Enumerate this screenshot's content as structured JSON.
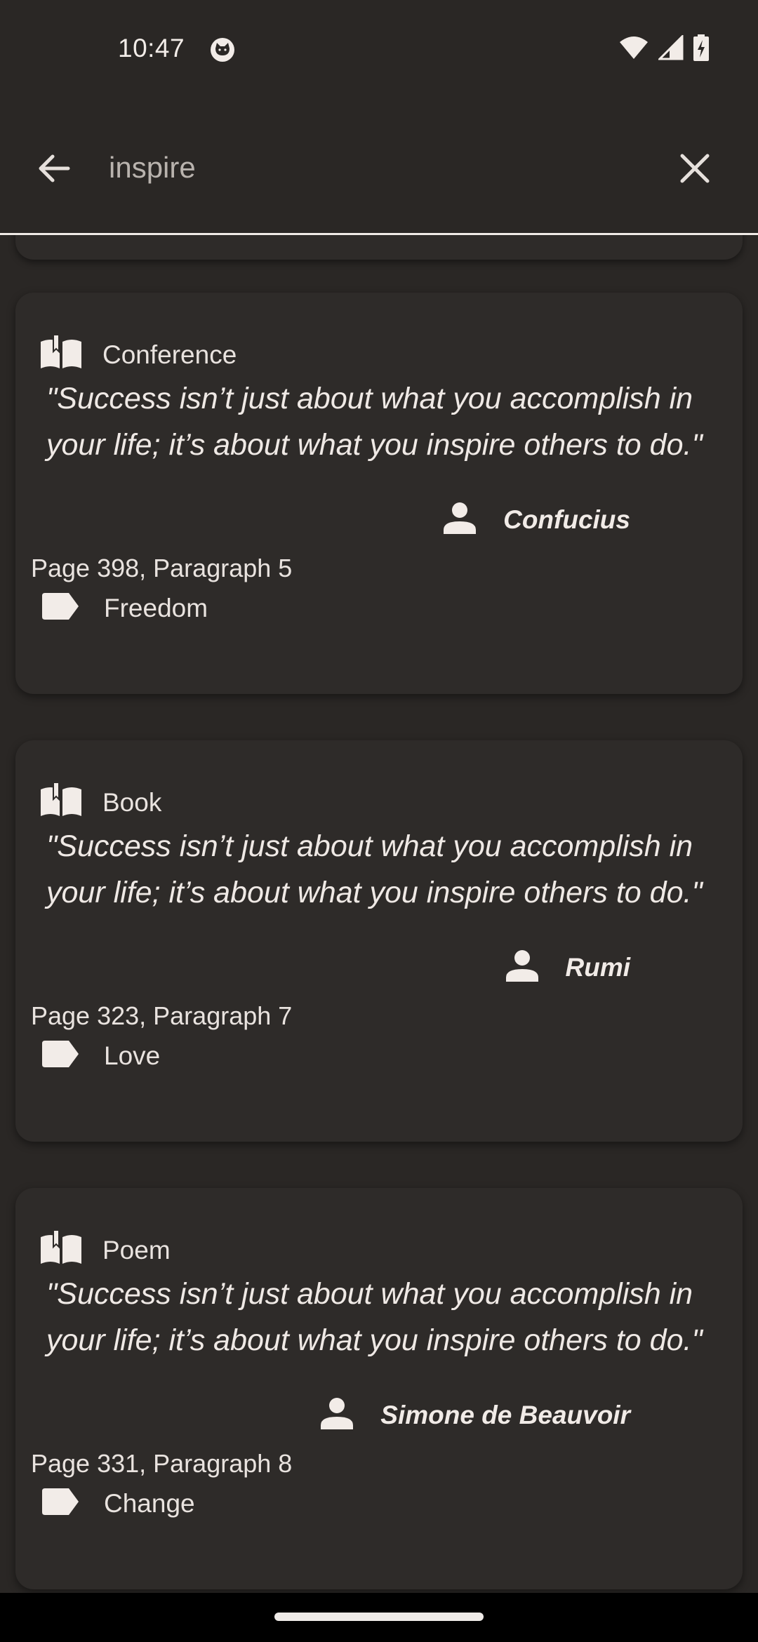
{
  "status_bar": {
    "time": "10:47",
    "app_icon": "cat-face-icon",
    "icons": [
      "wifi-icon",
      "signal-icon",
      "battery-charging-icon"
    ]
  },
  "search_bar": {
    "query": "inspire",
    "back_icon": "arrow-back-icon",
    "clear_icon": "close-icon"
  },
  "results": [
    {
      "type": "Conference",
      "quote": "\"Success isn’t just about what you accomplish in your life; it’s about what you inspire others to do.\"",
      "author": "Confucius",
      "page_ref": "Page 398, Paragraph 5",
      "tag": "Freedom"
    },
    {
      "type": "Book",
      "quote": "\"Success isn’t just about what you accomplish in your life; it’s about what you inspire others to do.\"",
      "author": "Rumi",
      "page_ref": "Page 323, Paragraph 7",
      "tag": "Love"
    },
    {
      "type": "Poem",
      "quote": "\"Success isn’t just about what you accomplish in your life; it’s about what you inspire others to do.\"",
      "author": "Simone de Beauvoir",
      "page_ref": "Page 331, Paragraph 8",
      "tag": "Change"
    }
  ],
  "colors": {
    "background": "#2a2725",
    "card": "#2e2b29",
    "text": "#ece6e2",
    "nav_bar": "#000000"
  }
}
